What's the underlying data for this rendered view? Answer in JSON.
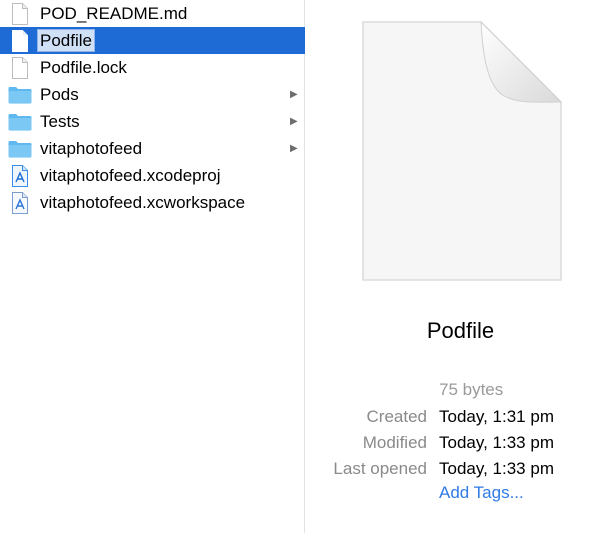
{
  "files": [
    {
      "label": "POD_README.md",
      "icon": "document-icon",
      "selected": false,
      "expandable": false
    },
    {
      "label": "Podfile",
      "icon": "document-icon",
      "selected": true,
      "expandable": false
    },
    {
      "label": "Podfile.lock",
      "icon": "document-icon",
      "selected": false,
      "expandable": false
    },
    {
      "label": "Pods",
      "icon": "folder-icon",
      "selected": false,
      "expandable": true
    },
    {
      "label": "Tests",
      "icon": "folder-icon",
      "selected": false,
      "expandable": true
    },
    {
      "label": "vitaphotofeed",
      "icon": "folder-icon",
      "selected": false,
      "expandable": true
    },
    {
      "label": "vitaphotofeed.xcodeproj",
      "icon": "xcode-project-icon",
      "selected": false,
      "expandable": false
    },
    {
      "label": "vitaphotofeed.xcworkspace",
      "icon": "xcode-workspace-icon",
      "selected": false,
      "expandable": false
    }
  ],
  "preview": {
    "name": "Podfile",
    "size": "75 bytes",
    "created_label": "Created",
    "created_value": "Today, 1:31 pm",
    "modified_label": "Modified",
    "modified_value": "Today, 1:33 pm",
    "last_opened_label": "Last opened",
    "last_opened_value": "Today, 1:33 pm",
    "add_tags": "Add Tags..."
  },
  "colors": {
    "selection": "#1e6bd6",
    "link": "#2f7ae5",
    "folder": "#5fb8f0"
  }
}
